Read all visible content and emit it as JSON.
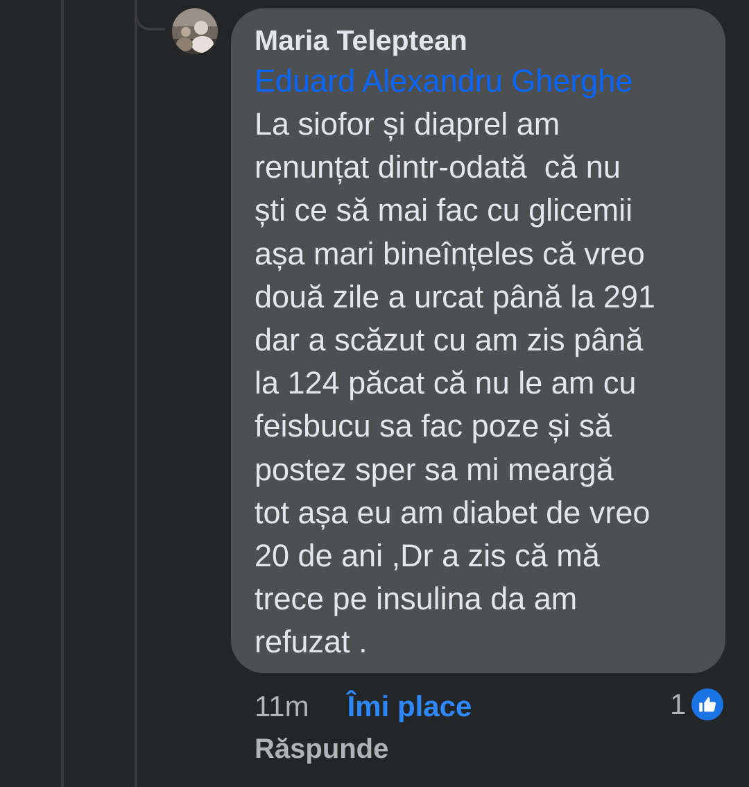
{
  "comment": {
    "author": "Maria Teleptean",
    "mention": "Eduard Alexandru Gherghe",
    "lines": [
      "La siofor și diaprel am",
      "renunțat dintr-odată  că nu",
      "ști ce să mai fac cu glicemii",
      "așa mari bineînțeles că vreo",
      "două zile a urcat până la 291",
      "dar a scăzut cu am zis până",
      "la 124 păcat că nu le am cu",
      "feisbucu sa fac poze și să",
      "postez sper sa mi meargă",
      "tot așa eu am diabet de vreo",
      "20 de ani ,Dr a zis că mă",
      "trece pe insulina da am",
      "refuzat ."
    ]
  },
  "actions": {
    "time": "11m",
    "like_label": "Îmi place",
    "reply_label": "Răspunde"
  },
  "reactions": {
    "count": "1",
    "icon": "like-thumb-icon"
  },
  "colors": {
    "background": "#242526",
    "bubble": "#4e4f50",
    "text": "#e4e6eb",
    "secondary_text": "#b0b3b8",
    "mention": "#0865fe",
    "like_action": "#2d88ff",
    "like_badge": "#1b74e4"
  }
}
